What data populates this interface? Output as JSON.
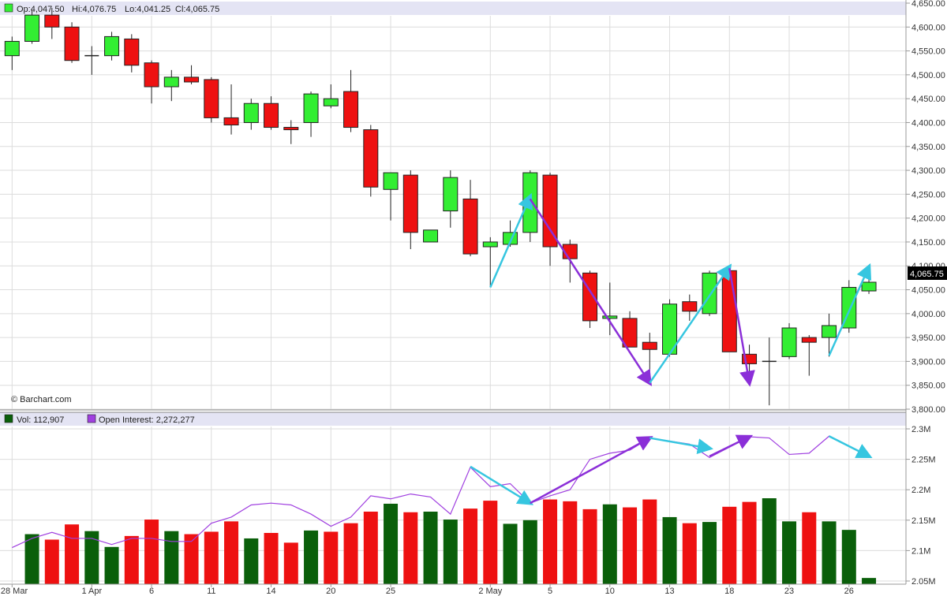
{
  "chart_data": [
    {
      "type": "candlestick",
      "legend": {
        "open_label": "Op:4,047.50",
        "high_label": "Hi:4,076.75",
        "low_label": "Lo:4,041.25",
        "close_label": "Cl:4,065.75"
      },
      "watermark": "© Barchart.com",
      "last_price_label": "4,065.75",
      "y_ticks": [
        "4,650.00",
        "4,600.00",
        "4,550.00",
        "4,500.00",
        "4,450.00",
        "4,400.00",
        "4,350.00",
        "4,300.00",
        "4,250.00",
        "4,200.00",
        "4,150.00",
        "4,100.00",
        "4,050.00",
        "4,000.00",
        "3,950.00",
        "3,900.00",
        "3,850.00",
        "3,800.00"
      ],
      "ylim": [
        3800,
        4650
      ],
      "grid": true,
      "candles": [
        {
          "o": 4540,
          "h": 4580,
          "l": 4510,
          "c": 4570
        },
        {
          "o": 4570,
          "h": 4635,
          "l": 4565,
          "c": 4625
        },
        {
          "o": 4625,
          "h": 4640,
          "l": 4575,
          "c": 4600
        },
        {
          "o": 4600,
          "h": 4610,
          "l": 4525,
          "c": 4530
        },
        {
          "o": 4540,
          "h": 4560,
          "l": 4500,
          "c": 4540
        },
        {
          "o": 4540,
          "h": 4590,
          "l": 4530,
          "c": 4580
        },
        {
          "o": 4575,
          "h": 4585,
          "l": 4505,
          "c": 4520
        },
        {
          "o": 4525,
          "h": 4530,
          "l": 4440,
          "c": 4475
        },
        {
          "o": 4475,
          "h": 4510,
          "l": 4445,
          "c": 4495
        },
        {
          "o": 4495,
          "h": 4520,
          "l": 4480,
          "c": 4485
        },
        {
          "o": 4490,
          "h": 4495,
          "l": 4400,
          "c": 4410
        },
        {
          "o": 4410,
          "h": 4480,
          "l": 4375,
          "c": 4395
        },
        {
          "o": 4400,
          "h": 4450,
          "l": 4385,
          "c": 4440
        },
        {
          "o": 4440,
          "h": 4455,
          "l": 4385,
          "c": 4390
        },
        {
          "o": 4390,
          "h": 4405,
          "l": 4355,
          "c": 4385
        },
        {
          "o": 4400,
          "h": 4465,
          "l": 4370,
          "c": 4460
        },
        {
          "o": 4435,
          "h": 4480,
          "l": 4430,
          "c": 4450
        },
        {
          "o": 4465,
          "h": 4510,
          "l": 4380,
          "c": 4390
        },
        {
          "o": 4385,
          "h": 4395,
          "l": 4245,
          "c": 4265
        },
        {
          "o": 4260,
          "h": 4295,
          "l": 4195,
          "c": 4295
        },
        {
          "o": 4290,
          "h": 4300,
          "l": 4135,
          "c": 4170
        },
        {
          "o": 4150,
          "h": 4175,
          "l": 4150,
          "c": 4175
        },
        {
          "o": 4215,
          "h": 4300,
          "l": 4180,
          "c": 4285
        },
        {
          "o": 4240,
          "h": 4280,
          "l": 4120,
          "c": 4125
        },
        {
          "o": 4140,
          "h": 4160,
          "l": 4055,
          "c": 4150
        },
        {
          "o": 4145,
          "h": 4195,
          "l": 4140,
          "c": 4170
        },
        {
          "o": 4170,
          "h": 4300,
          "l": 4150,
          "c": 4295
        },
        {
          "o": 4290,
          "h": 4295,
          "l": 4100,
          "c": 4140
        },
        {
          "o": 4145,
          "h": 4155,
          "l": 4065,
          "c": 4115
        },
        {
          "o": 4085,
          "h": 4090,
          "l": 3970,
          "c": 3985
        },
        {
          "o": 3990,
          "h": 4065,
          "l": 3955,
          "c": 3995
        },
        {
          "o": 3990,
          "h": 4005,
          "l": 3930,
          "c": 3930
        },
        {
          "o": 3940,
          "h": 3960,
          "l": 3855,
          "c": 3925
        },
        {
          "o": 3915,
          "h": 4030,
          "l": 3910,
          "c": 4020
        },
        {
          "o": 4025,
          "h": 4040,
          "l": 3985,
          "c": 4005
        },
        {
          "o": 4000,
          "h": 4090,
          "l": 3995,
          "c": 4085
        },
        {
          "o": 4090,
          "h": 4095,
          "l": 3920,
          "c": 3920
        },
        {
          "o": 3915,
          "h": 3935,
          "l": 3855,
          "c": 3895
        },
        {
          "o": 3900,
          "h": 3950,
          "l": 3808,
          "c": 3900
        },
        {
          "o": 3910,
          "h": 3980,
          "l": 3905,
          "c": 3970
        },
        {
          "o": 3950,
          "h": 3955,
          "l": 3870,
          "c": 3940
        },
        {
          "o": 3950,
          "h": 4000,
          "l": 3910,
          "c": 3975
        },
        {
          "o": 3970,
          "h": 4070,
          "l": 3960,
          "c": 4055
        },
        {
          "o": 4047.5,
          "h": 4076.75,
          "l": 4041.25,
          "c": 4065.75
        }
      ],
      "annotations": [
        {
          "color": "#36c6e0",
          "from": [
            24,
            4055
          ],
          "to": [
            26,
            4245
          ]
        },
        {
          "color": "#8b2fd8",
          "from": [
            26,
            4240
          ],
          "to": [
            32,
            3855
          ]
        },
        {
          "color": "#36c6e0",
          "from": [
            32,
            3855
          ],
          "to": [
            36,
            4098
          ]
        },
        {
          "color": "#8b2fd8",
          "from": [
            36,
            4095
          ],
          "to": [
            37,
            3855
          ]
        },
        {
          "color": "#36c6e0",
          "from": [
            41,
            3912
          ],
          "to": [
            43,
            4098
          ]
        }
      ]
    },
    {
      "type": "bar",
      "legend": {
        "vol_label": "Vol: 112,907",
        "oi_label": "Open Interest: 2,272,277"
      },
      "y_ticks": [
        "2.3M",
        "2.25M",
        "2.2M",
        "2.15M",
        "2.1M",
        "2.05M"
      ],
      "ylim": [
        2.05,
        2.3
      ],
      "volume_colors": [
        "g",
        "r",
        "r",
        "g",
        "g",
        "r",
        "r",
        "g",
        "r",
        "r",
        "r",
        "g",
        "r",
        "r",
        "g",
        "r",
        "r",
        "r",
        "g",
        "r",
        "g",
        "g",
        "r",
        "r",
        "g",
        "g",
        "r",
        "r",
        "r",
        "g",
        "r",
        "r",
        "g",
        "r",
        "g",
        "r",
        "r",
        "g",
        "g",
        "r",
        "g",
        "g",
        "g"
      ],
      "volume": [
        2.127,
        2.118,
        2.143,
        2.132,
        2.106,
        2.124,
        2.151,
        2.132,
        2.127,
        2.131,
        2.148,
        2.12,
        2.129,
        2.113,
        2.133,
        2.131,
        2.145,
        2.164,
        2.177,
        2.163,
        2.164,
        2.151,
        2.169,
        2.182,
        2.144,
        2.15,
        2.184,
        2.181,
        2.168,
        2.176,
        2.171,
        2.184,
        2.155,
        2.145,
        2.147,
        2.172,
        2.18,
        2.186,
        2.148,
        2.163,
        2.148,
        2.134,
        2.055
      ],
      "open_interest": [
        2.105,
        2.12,
        2.13,
        2.12,
        2.12,
        2.11,
        2.12,
        2.12,
        2.115,
        2.115,
        2.145,
        2.155,
        2.175,
        2.178,
        2.175,
        2.16,
        2.14,
        2.155,
        2.19,
        2.185,
        2.193,
        2.188,
        2.16,
        2.237,
        2.205,
        2.21,
        2.178,
        2.19,
        2.2,
        2.25,
        2.26,
        2.265,
        2.285,
        2.28,
        2.275,
        2.253,
        2.27,
        2.287,
        2.285,
        2.258,
        2.26,
        2.288,
        2.272
      ],
      "annotations": [
        {
          "color": "#36c6e0",
          "from": [
            23,
            2.238
          ],
          "to": [
            26,
            2.178
          ]
        },
        {
          "color": "#8b2fd8",
          "from": [
            26,
            2.178
          ],
          "to": [
            32,
            2.285
          ]
        },
        {
          "color": "#36c6e0",
          "from": [
            32,
            2.285
          ],
          "to": [
            35,
            2.268
          ]
        },
        {
          "color": "#8b2fd8",
          "from": [
            35,
            2.255
          ],
          "to": [
            37,
            2.287
          ]
        },
        {
          "color": "#36c6e0",
          "from": [
            41,
            2.288
          ],
          "to": [
            43,
            2.255
          ]
        }
      ]
    }
  ],
  "x_axis": {
    "labels": [
      {
        "index": 0,
        "text": "28 Mar"
      },
      {
        "index": 4,
        "text": "1 Apr"
      },
      {
        "index": 7,
        "text": "6"
      },
      {
        "index": 10,
        "text": "11"
      },
      {
        "index": 13,
        "text": "14"
      },
      {
        "index": 16,
        "text": "20"
      },
      {
        "index": 19,
        "text": "25"
      },
      {
        "index": 24,
        "text": "2 May"
      },
      {
        "index": 27,
        "text": "5"
      },
      {
        "index": 30,
        "text": "10"
      },
      {
        "index": 33,
        "text": "13"
      },
      {
        "index": 36,
        "text": "18"
      },
      {
        "index": 39,
        "text": "23"
      },
      {
        "index": 42,
        "text": "26"
      }
    ]
  },
  "colors": {
    "up": "#33ee33",
    "down": "#ee1111",
    "vol_up": "#0a5f0a",
    "vol_down": "#ee1111",
    "oi_line": "#a040e0",
    "grid": "#dcdcdc",
    "legend_bg": "#e4e4f4"
  }
}
